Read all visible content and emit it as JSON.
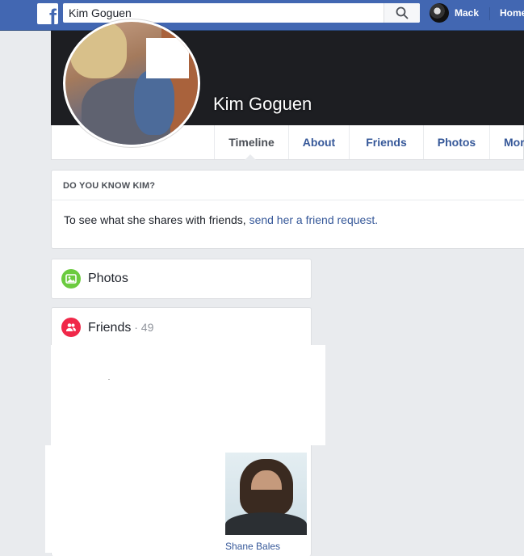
{
  "topbar": {
    "logo_letter": "f",
    "search_value": "Kim Goguen",
    "search_placeholder": "Search",
    "user_name": "Mack",
    "home_label": "Home"
  },
  "profile": {
    "name": "Kim Goguen"
  },
  "nav": {
    "tabs": [
      {
        "label": "Timeline"
      },
      {
        "label": "About"
      },
      {
        "label": "Friends"
      },
      {
        "label": "Photos"
      },
      {
        "label": "More"
      }
    ]
  },
  "know_card": {
    "title": "DO YOU KNOW KIM?",
    "text": "To see what she shares with friends, ",
    "link": "send her a friend request."
  },
  "photos_card": {
    "title": "Photos"
  },
  "friends_card": {
    "title": "Friends",
    "count": " · 49",
    "friends": [
      {
        "name": "Shane Bales"
      }
    ]
  },
  "colors": {
    "brand": "#4267b2",
    "link": "#365899",
    "photos_icon": "#6bcb3f",
    "friends_icon": "#f02849"
  }
}
